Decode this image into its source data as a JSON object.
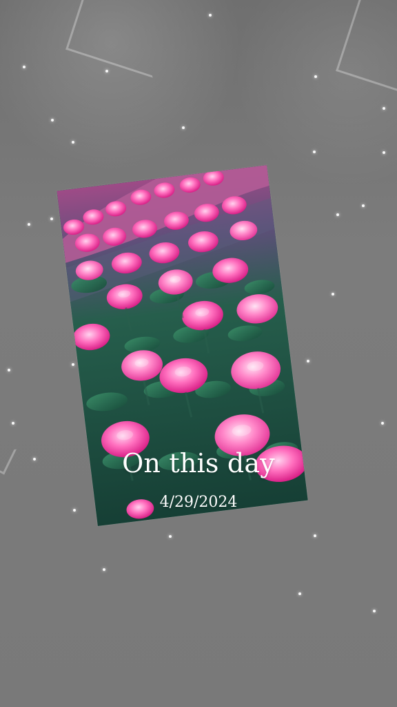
{
  "memory": {
    "title": "On this day",
    "date": "4/29/2024"
  },
  "icons": {
    "glass_shards": "glass-shard-icon",
    "sparkles": "sparkle-icon",
    "photo": "rose-field-photo"
  },
  "colors": {
    "background": "#7b7b7b",
    "rose_pink": "#f050a8",
    "leaf_green": "#1d5a49",
    "text": "#ffffff"
  }
}
